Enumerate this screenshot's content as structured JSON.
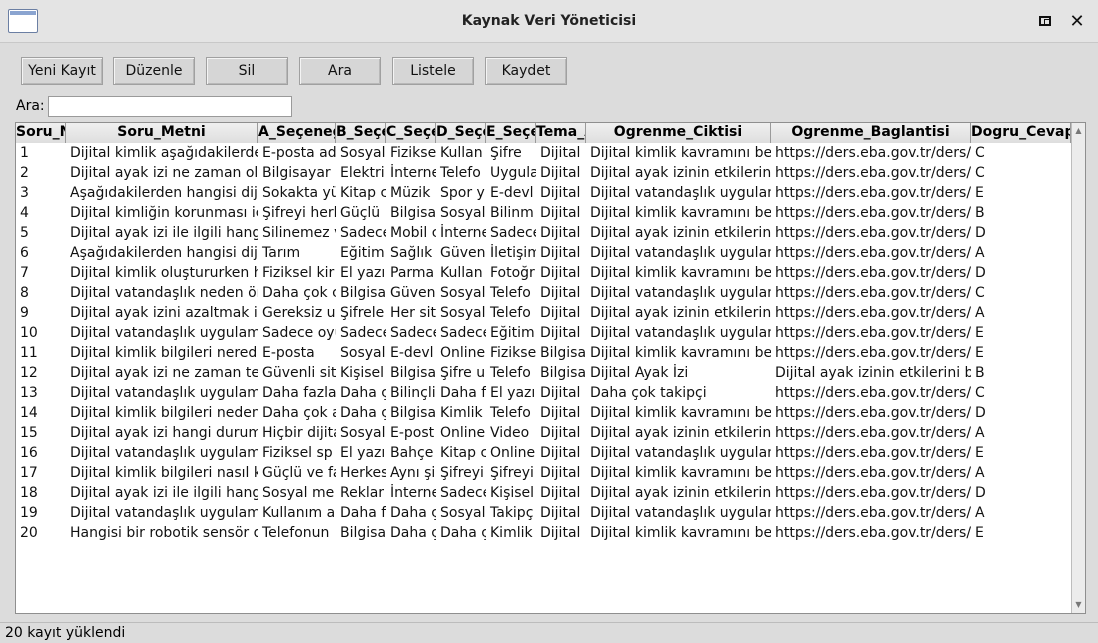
{
  "window": {
    "title": "Kaynak Veri Yöneticisi"
  },
  "titlebar": {
    "restore_glyph": "",
    "close_glyph": "✕"
  },
  "toolbar": {
    "buttons": [
      "Yeni Kayıt",
      "Düzenle",
      "Sil",
      "Ara",
      "Listele",
      "Kaydet"
    ]
  },
  "search": {
    "label": "Ara:",
    "value": "",
    "placeholder": ""
  },
  "table": {
    "headers": [
      "Soru_No",
      "Soru_Metni",
      "A_Seçeneği",
      "B_Seçeneği",
      "C_Seçeneği",
      "D_Seçeneği",
      "E_Seçeneği",
      "Tema_Adı",
      "Ogrenme_Ciktisi",
      "Ogrenme_Baglantisi",
      "Dogru_Cevap"
    ],
    "rows": [
      [
        "1",
        "Dijital kimlik aşağıdakilerden",
        "E-posta ad",
        "Sosyal",
        "Fiziksel",
        "Kullan",
        "Şifre",
        "Dijital",
        " Dijital kimlik kavramını be",
        "https://ders.eba.gov.tr/ders/pr",
        "C"
      ],
      [
        "2",
        "Dijital ayak izi ne zaman olu",
        "Bilgisayar",
        "Elektri",
        "İnterne",
        "Telefo",
        "Uygula",
        "Dijital",
        "Dijital ayak izinin etkilerini",
        "https://ders.eba.gov.tr/ders/pr",
        "C"
      ],
      [
        "3",
        "Aşağıdakilerden hangisi dijit",
        "Sokakta yü",
        "Kitap c",
        "Müzik",
        "Spor y",
        "E-devl",
        "Dijital",
        "Dijital vatandaşlık uygulam",
        "https://ders.eba.gov.tr/ders/pr",
        "E"
      ],
      [
        "4",
        "Dijital kimliğin korunması iç",
        "Şifreyi herk",
        "Güçlü",
        "Bilgisa",
        "Sosyal",
        "Bilinm",
        "Dijital",
        "Dijital kimlik kavramını bel",
        "https://ders.eba.gov.tr/ders/pr",
        "B"
      ],
      [
        "5",
        "Dijital ayak izi ile ilgili hang",
        "Silinemez v",
        "Sadece",
        "Mobil c",
        "İnterne",
        "Sadece",
        "Dijital",
        "Dijital ayak izinin etkilerini",
        "https://ders.eba.gov.tr/ders/pr",
        "D"
      ],
      [
        "6",
        "Aşağıdakilerden hangisi dijit",
        "Tarım",
        "Eğitim",
        "Sağlık",
        "Güven",
        "İletişim",
        "Dijital",
        "Dijital vatandaşlık uygulam",
        "https://ders.eba.gov.tr/ders/pr",
        "A"
      ],
      [
        "7",
        "Dijital kimlik oluştururken h",
        "Fiziksel kir",
        "El yazı",
        "Parma",
        "Kullan",
        "Fotoğr",
        "Dijital",
        "Dijital kimlik kavramını bel",
        "https://ders.eba.gov.tr/ders/pr",
        "D"
      ],
      [
        "8",
        "Dijital vatandaşlık neden ön",
        "Daha çok c",
        "Bilgisa",
        "Güven",
        "Sosyal",
        "Telefo",
        "Dijital",
        "Dijital vatandaşlık uygulam",
        "https://ders.eba.gov.tr/ders/pr",
        "C"
      ],
      [
        "9",
        "Dijital ayak izini azaltmak iç",
        "Gereksiz u",
        "Şifrele",
        "Her sit",
        "Sosyal",
        "Telefo",
        "Dijital",
        "Dijital ayak izinin etkilerini",
        "https://ders.eba.gov.tr/ders/pr",
        "A"
      ],
      [
        "10",
        "Dijital vatandaşlık uygulamı",
        "Sadece oyu",
        "Sadece",
        "Sadece",
        "Sadece",
        "Eğitim",
        "Dijital",
        "Dijital vatandaşlık uygulam",
        "https://ders.eba.gov.tr/ders/pr",
        "E"
      ],
      [
        "11",
        "Dijital kimlik bilgileri nerede",
        "E-posta",
        "Sosyal",
        "E-devl",
        "Online",
        "Fizikse",
        "Bilgisa",
        " Dijital kimlik kavramını be",
        "https://ders.eba.gov.tr/ders/pr",
        "E"
      ],
      [
        "12",
        "Dijital ayak izi ne zaman teh",
        "Güvenli sit",
        "Kişisel",
        "Bilgisa",
        "Şifre u",
        "Telefo",
        "Bilgisa",
        "Dijital Ayak İzi",
        "Dijital ayak izinin etkilerini bi",
        "B"
      ],
      [
        "13",
        "Dijital vatandaşlık uygulamı",
        "Daha fazla",
        "Daha ç",
        "Bilinçli",
        "Daha f",
        "El yazı",
        "Dijital",
        "Daha çok takipçi",
        "https://ders.eba.gov.tr/ders/pr",
        "C"
      ],
      [
        "14",
        "Dijital kimlik bilgileri neden",
        "Daha çok a",
        "Daha ç",
        "Bilgisa",
        "Kimlik",
        "Telefo",
        "Dijital",
        "Dijital kimlik kavramını bel",
        "https://ders.eba.gov.tr/ders/pr",
        "D"
      ],
      [
        "15",
        "Dijital ayak izi hangi durumc",
        "Hiçbir dijita",
        "Sosyal",
        "E-post",
        "Online",
        "Video",
        "Dijital",
        "Dijital ayak izinin etkilerini",
        "https://ders.eba.gov.tr/ders/pr",
        "A"
      ],
      [
        "16",
        "Dijital vatandaşlık uygulamı",
        "Fiziksel sp",
        "El yazı",
        "Bahçe",
        "Kitap c",
        "Online",
        "Dijital",
        "Dijital vatandaşlık uygulam",
        "https://ders.eba.gov.tr/ders/pr",
        "E"
      ],
      [
        "17",
        "Dijital kimlik bilgileri nasıl k",
        "Güçlü ve fa",
        "Herkes",
        "Aynı şi",
        "Şifreyi",
        "Şifreyi",
        "Dijital",
        " Dijital kimlik kavramını be",
        "https://ders.eba.gov.tr/ders/pr",
        "A"
      ],
      [
        "18",
        "Dijital ayak izi ile ilgili hang",
        "Sosyal me",
        "Reklar",
        "İnterne",
        "Sadece",
        "Kişisel",
        "Dijital",
        "Dijital ayak izinin etkilerini",
        "https://ders.eba.gov.tr/ders/pr",
        "D"
      ],
      [
        "19",
        "Dijital vatandaşlık uygulamı",
        "Kullanım a",
        "Daha f",
        "Daha ç",
        "Sosyal",
        "Takipç",
        "Dijital",
        "Dijital vatandaşlık uygulam",
        "https://ders.eba.gov.tr/ders/pr",
        "A"
      ],
      [
        "20",
        "Hangisi bir robotik sensör de",
        "Telefonun",
        "Bilgisa",
        "Daha ç",
        "Daha ç",
        "Kimlik",
        "Dijital",
        " Dijital kimlik kavramını be",
        "https://ders.eba.gov.tr/ders/pr",
        "E"
      ]
    ]
  },
  "scrollbar": {
    "up": "▲",
    "down": "▼"
  },
  "status": {
    "text": "20 kayıt yüklendi"
  }
}
